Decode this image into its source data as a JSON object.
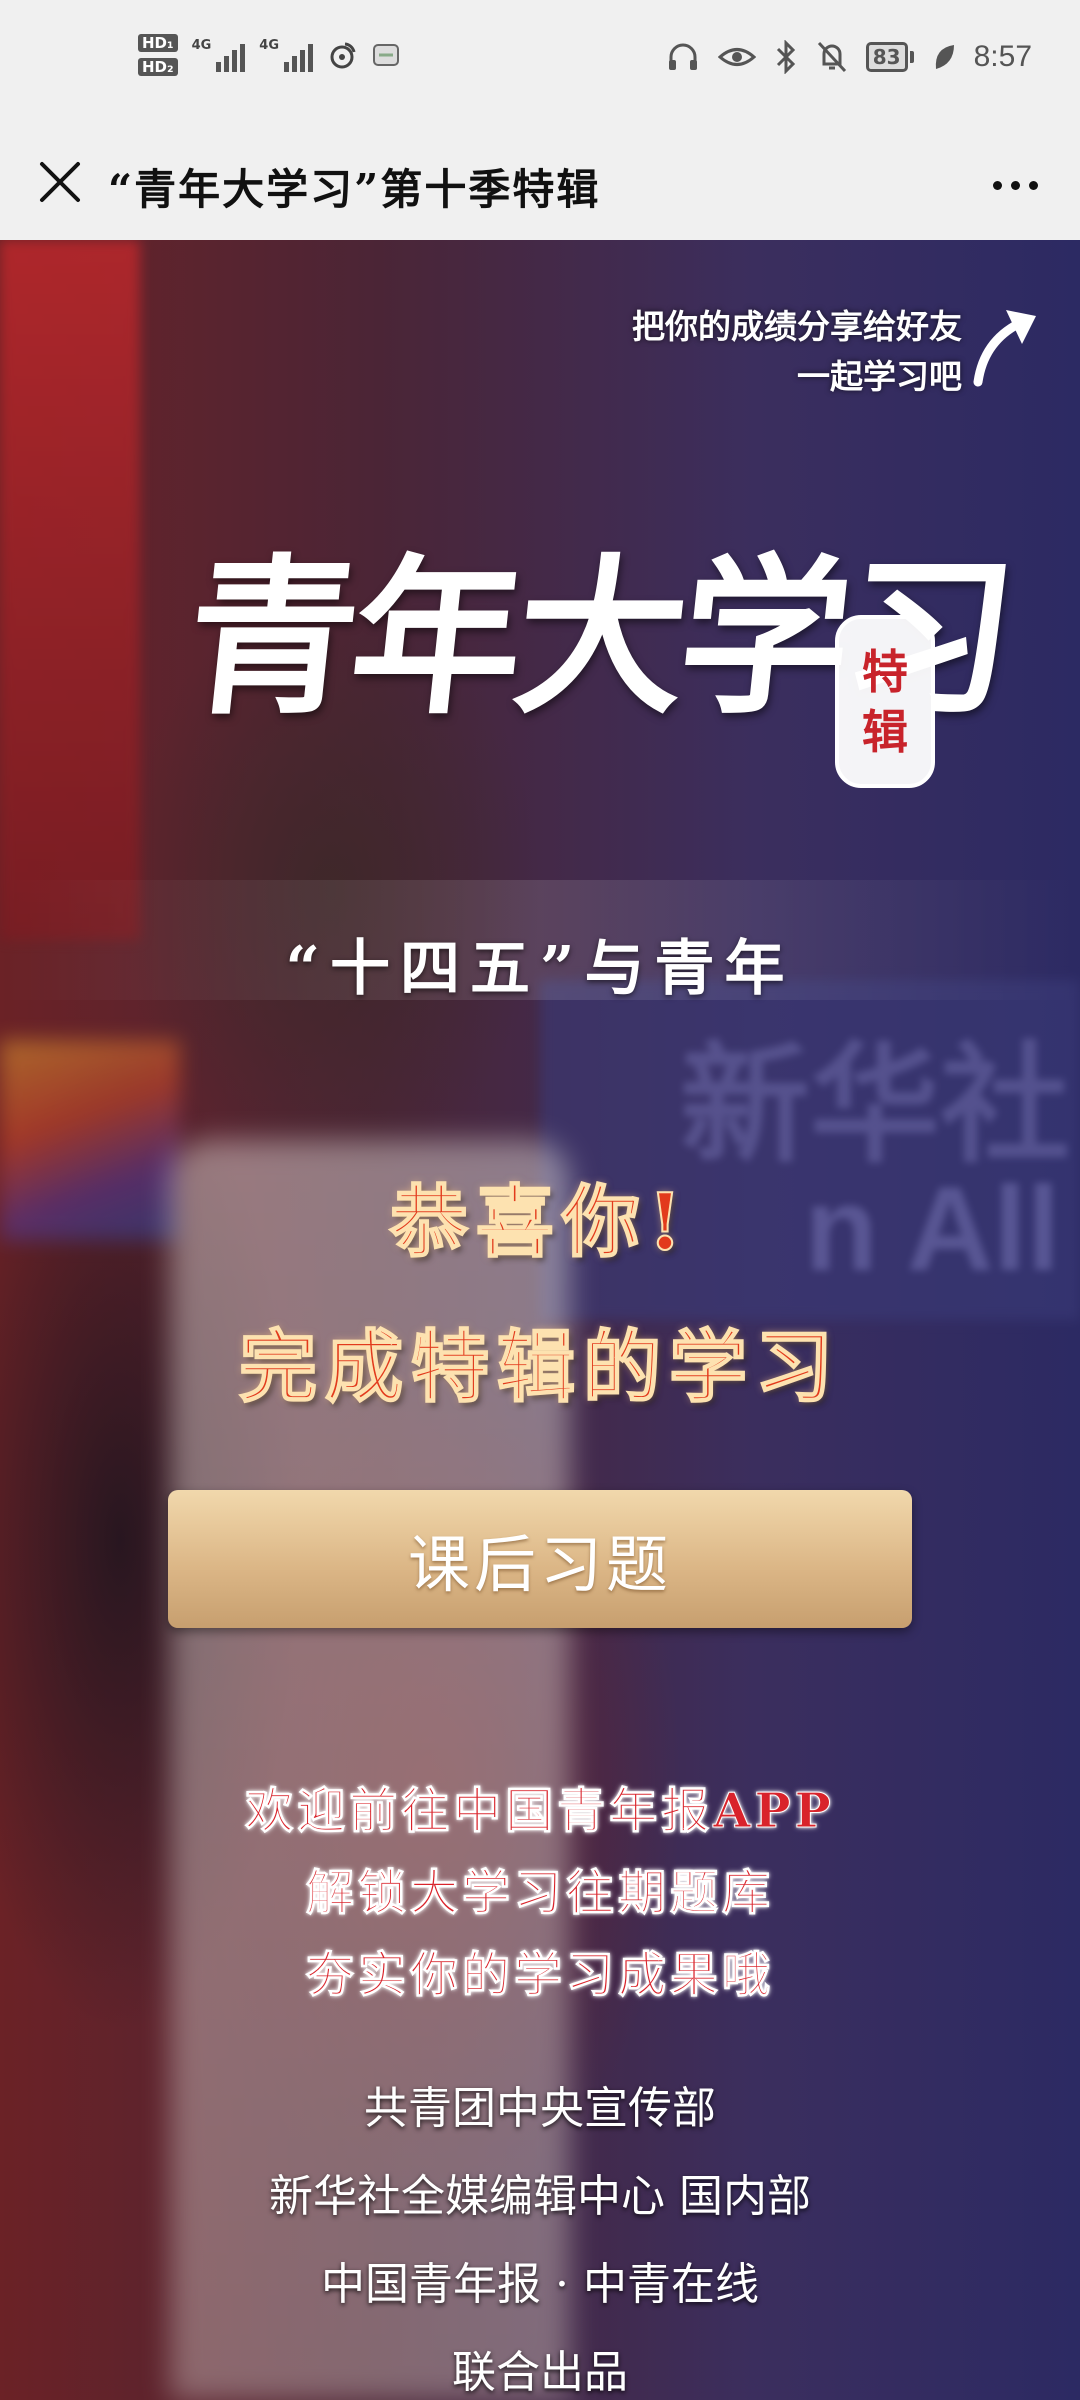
{
  "status_bar": {
    "hd_badges": [
      "HD₁",
      "HD₂"
    ],
    "signal_labels": [
      "4G",
      "4G"
    ],
    "battery_level": "83",
    "time": "8:57",
    "icons": [
      "headphones-icon",
      "eye-icon",
      "bluetooth-icon",
      "mute-icon",
      "battery-icon",
      "leaf-icon"
    ]
  },
  "title_bar": {
    "title": "“青年大学习”第十季特辑"
  },
  "content": {
    "share_hint": [
      "把你的成绩分享给好友",
      "一起学习吧"
    ],
    "logo_title": "青年大学习",
    "seal_chars": [
      "特",
      "辑"
    ],
    "subtitle": "“十四五”与青年",
    "congrats_lines": [
      "恭喜你!",
      "完成特辑的学习"
    ],
    "exercise_button": "课后习题",
    "app_promo": [
      "欢迎前往中国青年报APP",
      "解锁大学习往期题库",
      "夯实你的学习成果哦"
    ],
    "credits": [
      "共青团中央宣传部",
      "新华社全媒编辑中心 国内部",
      "中国青年报 · 中青在线",
      "联合出品"
    ],
    "background_text": [
      "新华社",
      "n All"
    ]
  },
  "colors": {
    "accent_red": "#e23a1c",
    "button_gold": "#dcb787",
    "background_purple": "#2c2a63"
  }
}
